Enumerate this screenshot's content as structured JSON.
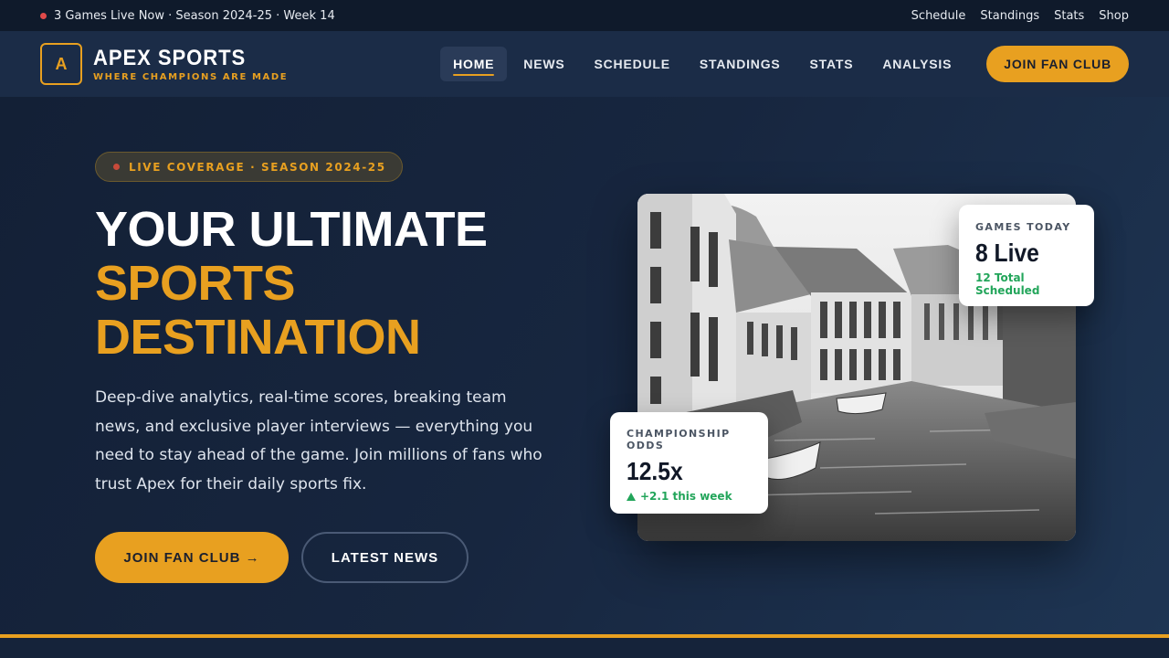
{
  "topbar": {
    "status": "3 Games Live Now · Season 2024-25 · Week 14",
    "links": [
      "Schedule",
      "Standings",
      "Stats",
      "Shop"
    ]
  },
  "header": {
    "logo_letter": "A",
    "brand": "APEX SPORTS",
    "tagline": "WHERE CHAMPIONS ARE MADE",
    "nav": [
      "HOME",
      "NEWS",
      "SCHEDULE",
      "STANDINGS",
      "STATS",
      "ANALYSIS"
    ],
    "active_nav": "HOME",
    "cta": "JOIN FAN CLUB"
  },
  "hero": {
    "badge": "LIVE COVERAGE · SEASON 2024-25",
    "headline_line1": "YOUR ULTIMATE",
    "headline_line2": "SPORTS",
    "headline_line3": "DESTINATION",
    "description": "Deep-dive analytics, real-time scores, breaking team news, and exclusive player interviews — everything you need to stay ahead of the game. Join millions of fans who trust Apex for their daily sports fix.",
    "primary_button": "JOIN FAN CLUB →",
    "secondary_button": "LATEST NEWS"
  },
  "cards": {
    "today": {
      "label": "GAMES TODAY",
      "value": "8 Live",
      "sub": "12 Total Scheduled"
    },
    "odds": {
      "label": "CHAMPIONSHIP ODDS",
      "value": "12.5x",
      "sub": "+2.1 this week"
    }
  },
  "colors": {
    "accent": "#e8a020",
    "positive": "#22a55a",
    "live": "#e04a4a"
  }
}
